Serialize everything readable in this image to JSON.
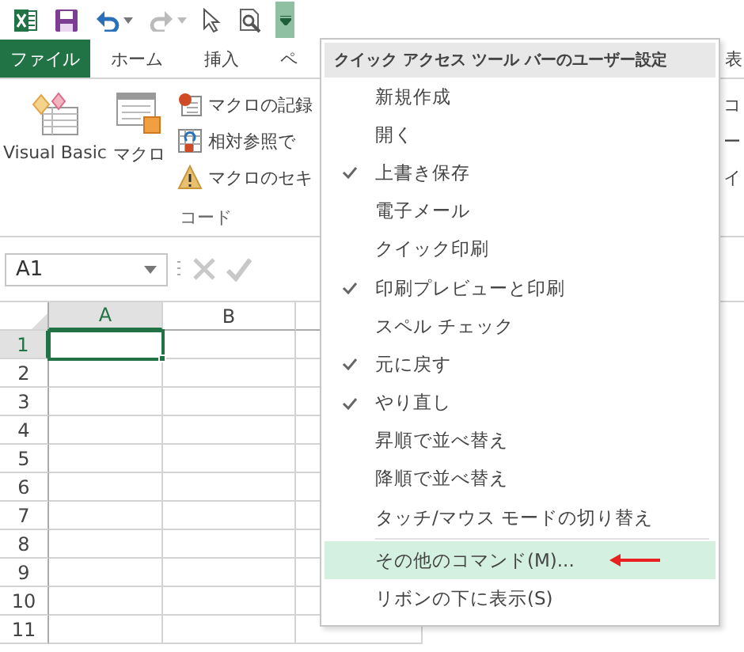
{
  "tabs": [
    {
      "label": "ファイル",
      "kind": "file",
      "selected": false
    },
    {
      "label": "ホーム",
      "kind": "tab",
      "selected": false
    },
    {
      "label": "挿入",
      "kind": "tab",
      "selected": false
    },
    {
      "label": "ペ",
      "kind": "tab",
      "selected": false
    },
    {
      "label": "表",
      "kind": "edge",
      "selected": false
    }
  ],
  "ribbon": {
    "large_buttons": [
      {
        "label": "Visual Basic",
        "kind": "vb"
      },
      {
        "label": "マクロ",
        "kind": "macro"
      }
    ],
    "small_buttons": [
      {
        "label": "マクロの記録",
        "kind": "record"
      },
      {
        "label": "相対参照で",
        "kind": "relative"
      },
      {
        "label": "マクロのセキ",
        "kind": "security"
      }
    ],
    "group_label": "コード",
    "right_fragments": [
      "コ",
      "ー",
      "イ"
    ]
  },
  "name_box": "A1",
  "columns": [
    {
      "label": "A",
      "active": true
    },
    {
      "label": "B",
      "active": false
    }
  ],
  "rows": [
    {
      "label": "1",
      "active": true
    },
    {
      "label": "2",
      "active": false
    },
    {
      "label": "3",
      "active": false
    },
    {
      "label": "4",
      "active": false
    },
    {
      "label": "5",
      "active": false
    },
    {
      "label": "6",
      "active": false
    },
    {
      "label": "7",
      "active": false
    },
    {
      "label": "8",
      "active": false
    },
    {
      "label": "9",
      "active": false
    },
    {
      "label": "10",
      "active": false
    },
    {
      "label": "11",
      "active": false
    }
  ],
  "menu": {
    "title": "クイック アクセス ツール バーのユーザー設定",
    "items": [
      {
        "label": "新規作成",
        "checked": false,
        "selected": false
      },
      {
        "label": "開く",
        "checked": false,
        "selected": false
      },
      {
        "label": "上書き保存",
        "checked": true,
        "selected": false
      },
      {
        "label": "電子メール",
        "checked": false,
        "selected": false
      },
      {
        "label": "クイック印刷",
        "checked": false,
        "selected": false
      },
      {
        "label": "印刷プレビューと印刷",
        "checked": true,
        "selected": false
      },
      {
        "label": "スペル チェック",
        "checked": false,
        "selected": false
      },
      {
        "label": "元に戻す",
        "checked": true,
        "selected": false
      },
      {
        "label": "やり直し",
        "checked": true,
        "selected": false
      },
      {
        "label": "昇順で並べ替え",
        "checked": false,
        "selected": false
      },
      {
        "label": "降順で並べ替え",
        "checked": false,
        "selected": false
      },
      {
        "label": "タッチ/マウス モードの切り替え",
        "checked": false,
        "selected": false
      },
      {
        "kind": "separator"
      },
      {
        "label": "その他のコマンド(M)...",
        "checked": false,
        "selected": true,
        "pointer_arrow": true
      },
      {
        "label": "リボンの下に表示(S)",
        "checked": false,
        "selected": false
      }
    ]
  }
}
